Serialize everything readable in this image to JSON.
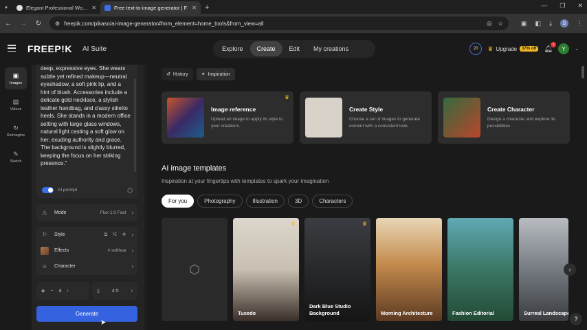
{
  "browser": {
    "tabs": [
      {
        "title": "Elegant Professional Woman in",
        "active": false,
        "favicon_color": "#e0e0e0"
      },
      {
        "title": "Free text-to-image generator | F",
        "active": true,
        "favicon_color": "#3b6ee6"
      }
    ],
    "url": "freepik.com/pikaso/ai-image-generator#from_element=home_tools&from_view=all",
    "profile_initial": "S"
  },
  "header": {
    "logo": "FREEP!K",
    "suite": "AI Suite",
    "nav": [
      "Explore",
      "Create",
      "Edit",
      "My creations"
    ],
    "active_nav": "Create",
    "credits": "20",
    "upgrade": "Upgrade",
    "offer": "37% off",
    "notif_count": "1",
    "avatar": "Y"
  },
  "rail": [
    {
      "label": "Images",
      "icon": "image-icon",
      "active": true
    },
    {
      "label": "Videos",
      "icon": "video-icon",
      "active": false
    },
    {
      "label": "Reimagine",
      "icon": "reimagine-icon",
      "active": false
    },
    {
      "label": "Sketch",
      "icon": "sketch-icon",
      "active": false
    }
  ],
  "panel": {
    "prompt": "deep, expressive eyes. She wears subtle yet refined makeup—neutral eyeshadow, a soft pink lip, and a hint of blush. Accessories include a delicate gold necklace, a stylish leather handbag, and classy stiletto heels. She stands in a modern office setting with large glass windows, natural light casting a soft glow on her, exuding authority and grace. The background is slightly blurred, keeping the focus on her striking presence.\"",
    "ai_prompt": "AI prompt",
    "mode_label": "Mode",
    "mode_value": "Flux 1.0 Fast",
    "style_label": "Style",
    "effects_label": "Effects",
    "effects_value": "# softhue",
    "character_label": "Character",
    "quantity": "4",
    "ratio": "4:5",
    "generate": "Generate"
  },
  "main": {
    "tabs": [
      "History",
      "Inspiration"
    ],
    "cards": [
      {
        "title": "Image reference",
        "desc": "Upload an image to apply its style to your creations.",
        "premium": true
      },
      {
        "title": "Create Style",
        "desc": "Choose a set of images to generate content with a consistent look.",
        "premium": false
      },
      {
        "title": "Create Character",
        "desc": "Design a character and explore its possibilities.",
        "premium": false
      }
    ],
    "templates_title": "AI image templates",
    "templates_sub": "Inspiration at your fingertips with templates to spark your imagination",
    "chips": [
      "For you",
      "Photography",
      "Illustration",
      "3D",
      "Characters"
    ],
    "tiles": [
      {
        "label": "Tuxedo",
        "premium": true
      },
      {
        "label": "Dark Blue Studio Background",
        "premium": true
      },
      {
        "label": "Morning Architecture",
        "premium": false
      },
      {
        "label": "Fashion Editorial",
        "premium": false
      },
      {
        "label": "Surreal Landscape",
        "premium": false
      }
    ]
  },
  "colors": {
    "accent": "#3563e0",
    "premium": "#f2b820",
    "background": "#1a1a1a"
  }
}
